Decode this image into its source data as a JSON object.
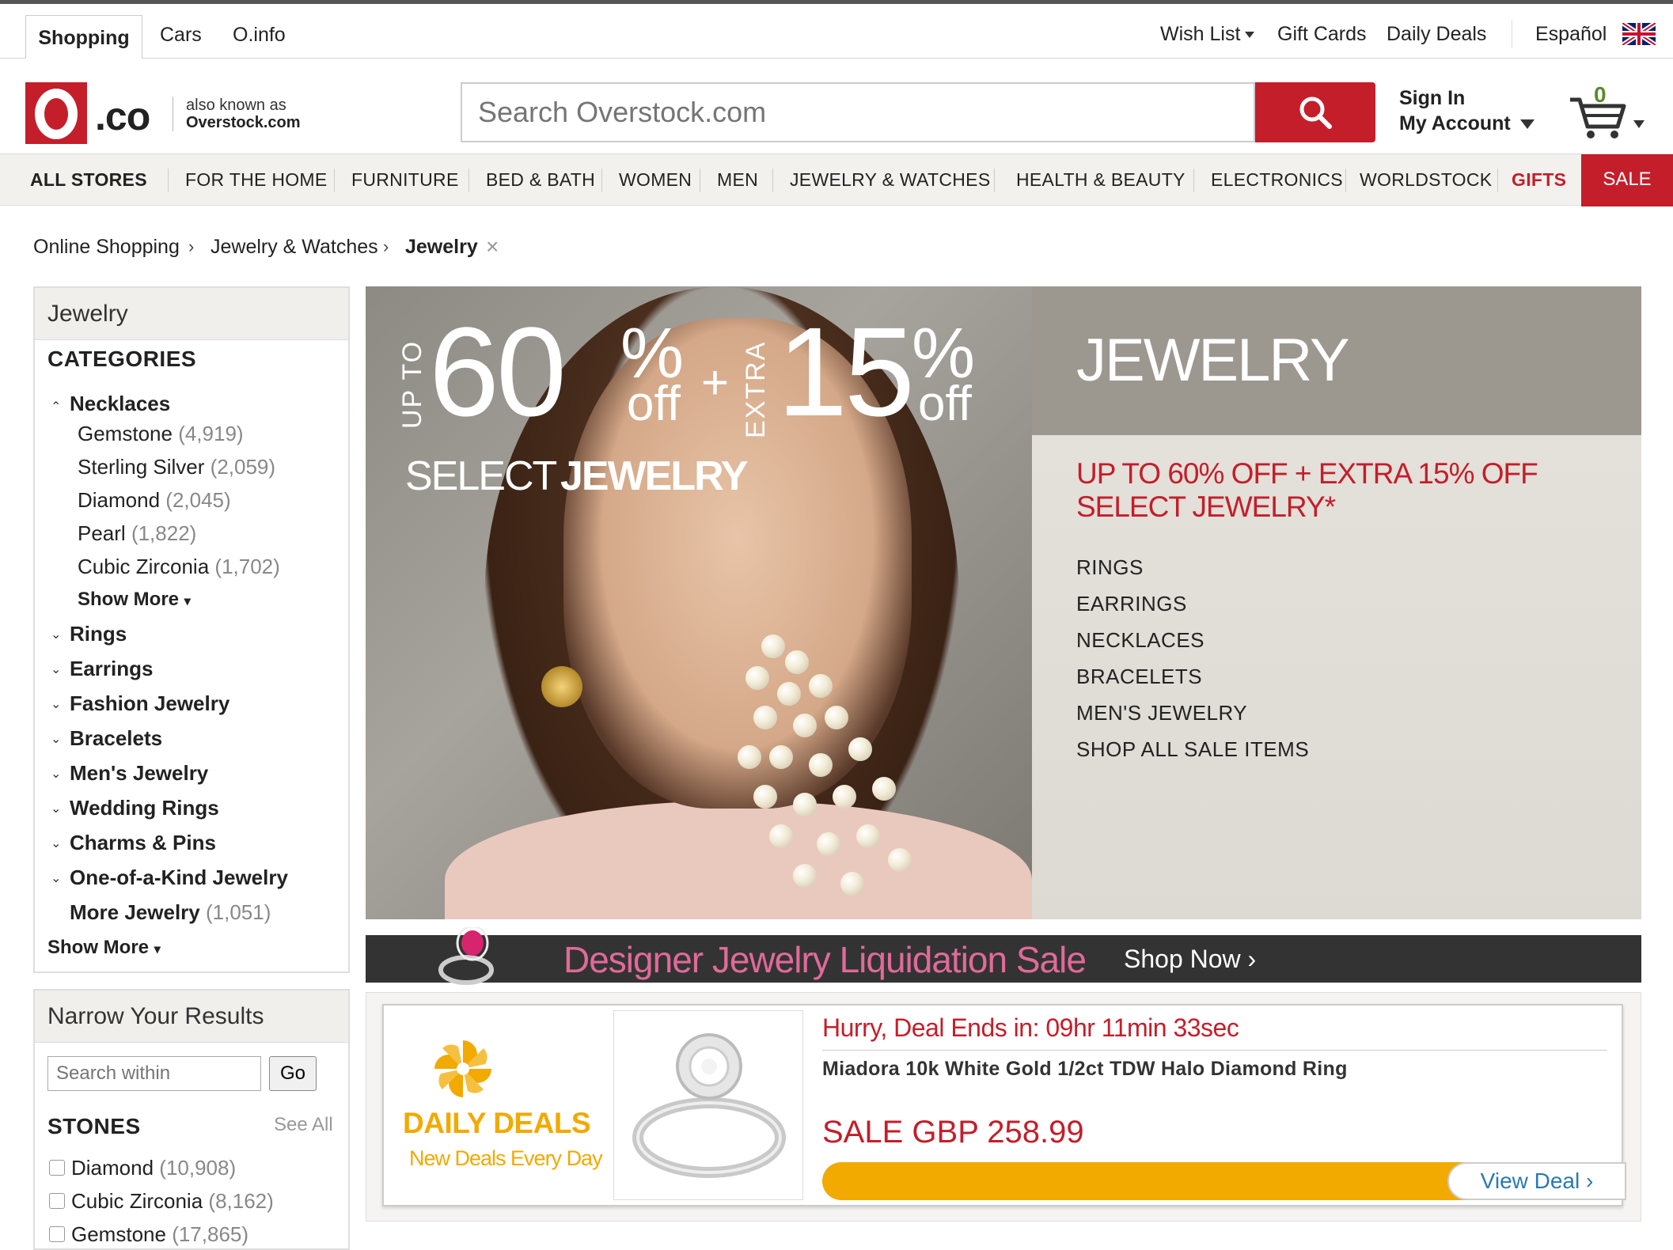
{
  "topbar": {
    "tabs": [
      "Shopping",
      "Cars",
      "O.info"
    ],
    "wish_list": "Wish List",
    "gift_cards": "Gift Cards",
    "daily_deals": "Daily Deals",
    "language": "Español"
  },
  "header": {
    "logo_co": ".co",
    "aka_line1": "also known as",
    "aka_line2": "Overstock.com",
    "search_placeholder": "Search Overstock.com",
    "sign_in": "Sign In",
    "my_account": "My Account",
    "cart_count": "0"
  },
  "nav": {
    "all_stores": "ALL STORES",
    "items": [
      "FOR THE HOME",
      "FURNITURE",
      "BED & BATH",
      "WOMEN",
      "MEN",
      "JEWELRY & WATCHES",
      "HEALTH & BEAUTY",
      "ELECTRONICS",
      "WORLDSTOCK",
      "GIFTS"
    ],
    "sale": "SALE"
  },
  "breadcrumb": {
    "items": [
      "Online Shopping",
      "Jewelry & Watches",
      "Jewelry"
    ],
    "sep": "›",
    "close": "×"
  },
  "sidebar": {
    "title": "Jewelry",
    "categories_label": "CATEGORIES",
    "necklaces": "Necklaces",
    "necklace_subs": [
      {
        "name": "Gemstone",
        "count": "(4,919)"
      },
      {
        "name": "Sterling Silver",
        "count": "(2,059)"
      },
      {
        "name": "Diamond",
        "count": "(2,045)"
      },
      {
        "name": "Pearl",
        "count": "(1,822)"
      },
      {
        "name": "Cubic Zirconia",
        "count": "(1,702)"
      }
    ],
    "show_more_sub": "Show More",
    "categories": [
      "Rings",
      "Earrings",
      "Fashion Jewelry",
      "Bracelets",
      "Men's Jewelry",
      "Wedding Rings",
      "Charms & Pins",
      "One-of-a-Kind Jewelry"
    ],
    "more_jewelry": "More Jewelry",
    "more_jewelry_count": "(1,051)",
    "show_more": "Show More"
  },
  "narrow": {
    "title": "Narrow Your Results",
    "search_placeholder": "Search within",
    "go": "Go",
    "stones_label": "STONES",
    "see_all": "See All",
    "stones": [
      {
        "name": "Diamond",
        "count": "(10,908)"
      },
      {
        "name": "Cubic Zirconia",
        "count": "(8,162)"
      },
      {
        "name": "Gemstone",
        "count": "(17,865)"
      }
    ]
  },
  "hero": {
    "up_to": "UP TO",
    "pct1": "60",
    "pct_sign": "%",
    "off": "off",
    "plus": "+",
    "extra": "EXTRA",
    "pct2": "15",
    "select": "SELECT",
    "jewelry_word": "JEWELRY",
    "title": "JEWELRY",
    "sub_line1": "UP TO 60% OFF + EXTRA 15% OFF",
    "sub_line2": "SELECT JEWELRY*",
    "links": [
      "RINGS",
      "EARRINGS",
      "NECKLACES",
      "BRACELETS",
      "MEN'S JEWELRY",
      "SHOP ALL SALE ITEMS"
    ]
  },
  "banner": {
    "text": "Designer Jewelry Liquidation Sale",
    "shop_now": "Shop Now ›"
  },
  "deal": {
    "logo_title": "DAILY DEALS",
    "logo_sub": "New Deals Every Day",
    "hurry": "Hurry, Deal Ends in: 09hr 11min 33sec",
    "name": "Miadora 10k White Gold 1/2ct TDW Halo Diamond Ring",
    "price": "SALE GBP 258.99",
    "view_deal": "View Deal ›"
  },
  "colors": {
    "brand_red": "#c41e2a",
    "deal_yellow": "#f2a900",
    "link_blue": "#2a7ab0"
  }
}
